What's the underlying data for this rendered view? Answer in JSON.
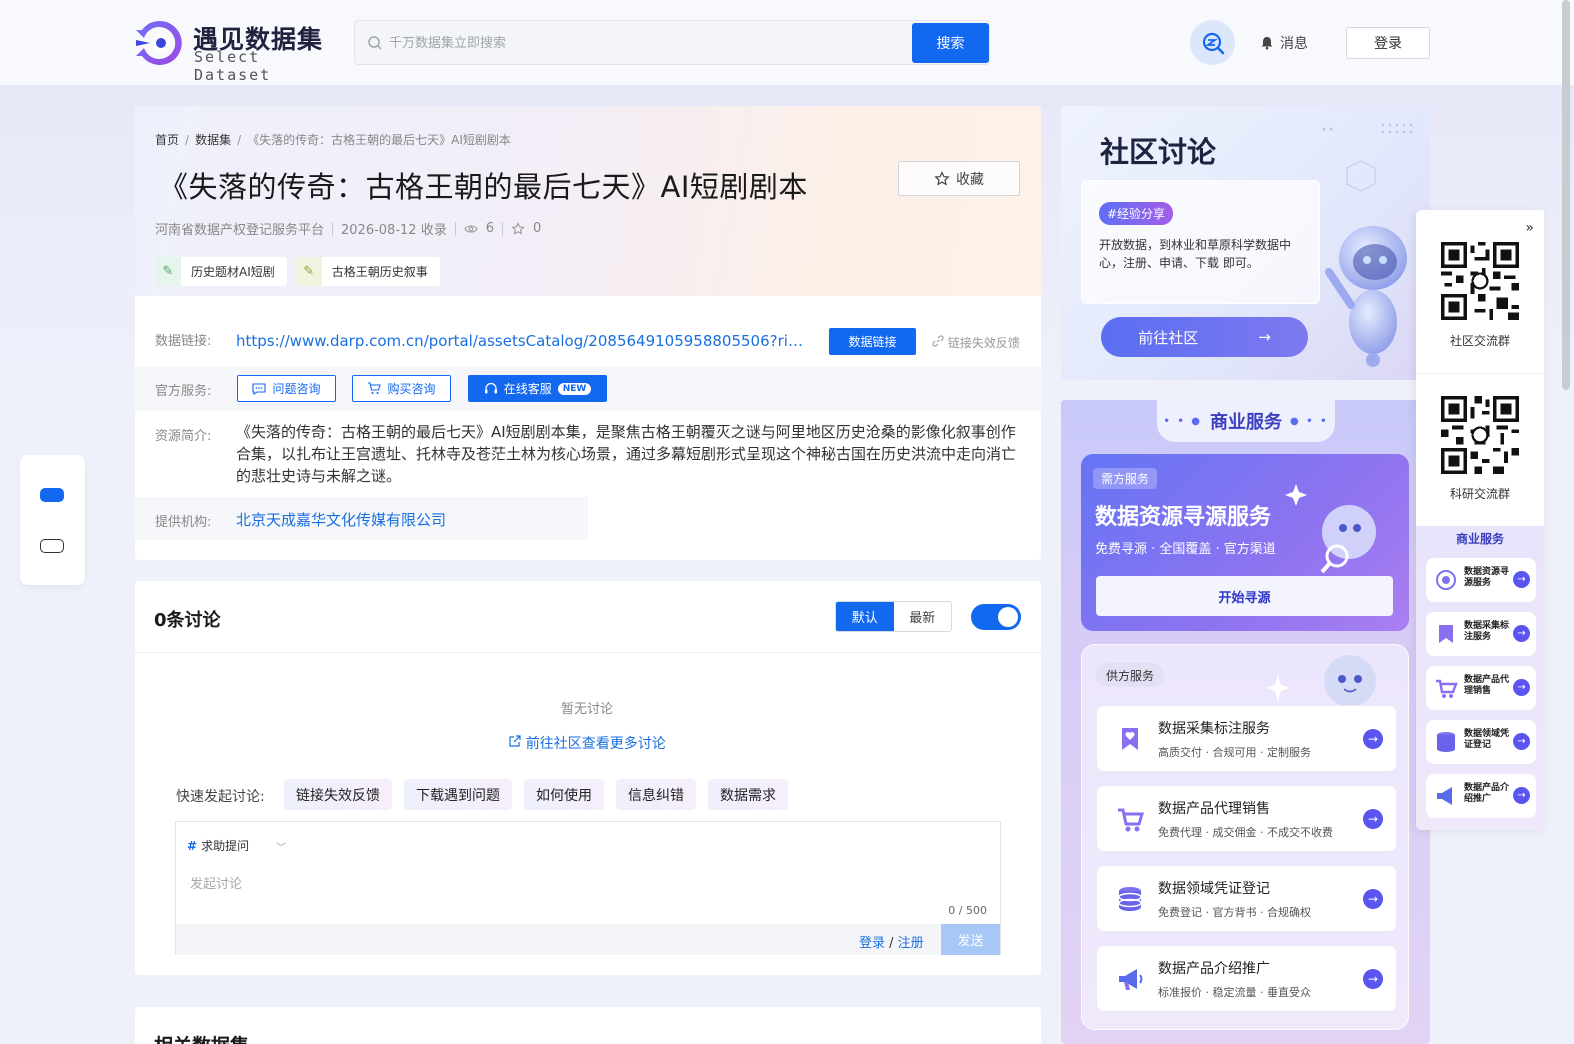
{
  "brand": {
    "name_cn": "遇见数据集",
    "name_en": "Select Dataset"
  },
  "header": {
    "search_placeholder": "千万数据集立即搜索",
    "search_button": "搜索",
    "messages": "消息",
    "login": "登录"
  },
  "breadcrumb": {
    "home": "首页",
    "datasets": "数据集",
    "current": "《失落的传奇：古格王朝的最后七天》AI短剧剧本"
  },
  "dataset": {
    "title": "《失落的传奇：古格王朝的最后七天》AI短剧剧本",
    "collect": "收藏",
    "source": "河南省数据产权登记服务平台",
    "collected_date": "2026-08-12 收录",
    "views": "6",
    "stars": "0",
    "tags": [
      "历史题材AI短剧",
      "古格王朝历史叙事"
    ],
    "link_label": "数据链接:",
    "link_url": "https://www.darp.com.cn/portal/assetsCatalog/2085649105958805506?rightHo...",
    "link_button": "数据链接",
    "link_feedback": "链接失效反馈",
    "service_label": "官方服务:",
    "services": {
      "ask": "问题咨询",
      "buy": "购买咨询",
      "online": "在线客服",
      "new_badge": "NEW"
    },
    "intro_label": "资源简介:",
    "intro": "《失落的传奇：古格王朝的最后七天》AI短剧剧本集，是聚焦古格王朝覆灭之谜与阿里地区历史沧桑的影像化叙事创作合集，以扎布让王宫遗址、托林寺及苍茫土林为核心场景，通过多幕短剧形式呈现这个神秘古国在历史洪流中走向消亡的悲壮史诗与未解之谜。",
    "org_label": "提供机构:",
    "org": "北京天成嘉华文化传媒有限公司"
  },
  "discussion": {
    "title": "0条讨论",
    "sort_default": "默认",
    "sort_latest": "最新",
    "empty": "暂无讨论",
    "goto_community": "前往社区查看更多讨论",
    "quick_label": "快速发起讨论:",
    "quick_tags": [
      "链接失效反馈",
      "下载遇到问题",
      "如何使用",
      "信息纠错",
      "数据需求"
    ],
    "topic": "求助提问",
    "placeholder": "发起讨论",
    "count": "0 / 500",
    "login": "登录",
    "register": "注册",
    "send": "发送"
  },
  "related": {
    "title": "相关数据集"
  },
  "community": {
    "title": "社区讨论",
    "tag": "#经验分享",
    "text": "开放数据，到林业和草原科学数据中心，注册、申请、下载 即可。",
    "button": "前往社区"
  },
  "business": {
    "title": "商业服务",
    "demand": {
      "tag": "需方服务",
      "title": "数据资源寻源服务",
      "sub": "免费寻源 · 全国覆盖 · 官方渠道",
      "button": "开始寻源"
    },
    "supply_tag": "供方服务",
    "items": [
      {
        "title": "数据采集标注服务",
        "sub": "高质交付 · 合规可用 · 定制服务"
      },
      {
        "title": "数据产品代理销售",
        "sub": "免费代理 · 成交佣金 · 不成交不收费"
      },
      {
        "title": "数据领域凭证登记",
        "sub": "免费登记 · 官方背书 · 合规确权"
      },
      {
        "title": "数据产品介绍推广",
        "sub": "标准报价 · 稳定流量 · 垂直受众"
      }
    ]
  },
  "side_panel": {
    "qr1": "社区交流群",
    "qr2": "科研交流群",
    "biz_title": "商业服务",
    "items": [
      "数据资源寻源服务",
      "数据采集标注服务",
      "数据产品代理销售",
      "数据领域凭证登记",
      "数据产品介绍推广"
    ]
  },
  "colors": {
    "primary": "#1368f0",
    "link": "#1a6fe0",
    "purple": "#5a55ee"
  }
}
